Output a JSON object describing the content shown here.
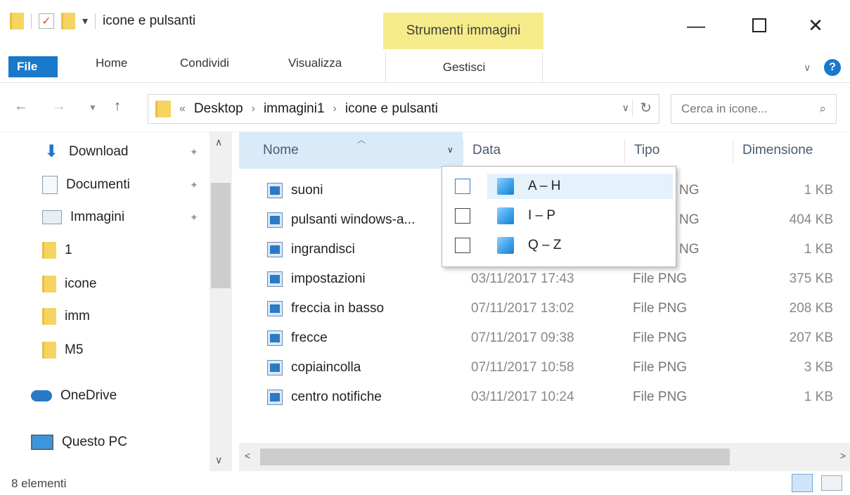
{
  "window": {
    "title": "icone e pulsanti",
    "contextual_tab": "Strumenti immagini",
    "minimize_glyph": "—",
    "maximize_glyph": "☐",
    "close_glyph": "✕"
  },
  "ribbon": {
    "tabs": [
      "File",
      "Home",
      "Condividi",
      "Visualizza"
    ],
    "contextual_subtab": "Gestisci",
    "help": "?"
  },
  "address": {
    "overflow": "«",
    "crumbs": [
      "Desktop",
      "immagini1",
      "icone e pulsanti"
    ],
    "search_placeholder": "Cerca in icone..."
  },
  "nav_pane": {
    "items": [
      {
        "label": "Download",
        "icon": "download-icon",
        "pinned": true
      },
      {
        "label": "Documenti",
        "icon": "documents-icon",
        "pinned": true
      },
      {
        "label": "Immagini",
        "icon": "pictures-icon",
        "pinned": true
      },
      {
        "label": "1",
        "icon": "folder-icon",
        "pinned": false
      },
      {
        "label": "icone",
        "icon": "folder-icon",
        "pinned": false
      },
      {
        "label": "imm",
        "icon": "folder-icon",
        "pinned": false
      },
      {
        "label": "M5",
        "icon": "folder-icon",
        "pinned": false
      },
      {
        "label": "OneDrive",
        "icon": "onedrive-icon",
        "pinned": false
      },
      {
        "label": "Questo PC",
        "icon": "this-pc-icon",
        "pinned": false
      }
    ]
  },
  "columns": {
    "name": "Nome",
    "date": "Data",
    "type": "Tipo",
    "size": "Dimensione"
  },
  "files": [
    {
      "name": "suoni",
      "date": "",
      "type": "",
      "size": "1 KB"
    },
    {
      "name": "pulsanti windows-a...",
      "date": "",
      "type": "",
      "size": "404 KB"
    },
    {
      "name": "ingrandisci",
      "date": "",
      "type": "",
      "size": "1 KB"
    },
    {
      "name": "impostazioni",
      "date": "03/11/2017 17:43",
      "type": "File PNG",
      "size": "375 KB"
    },
    {
      "name": "freccia in basso",
      "date": "07/11/2017 13:02",
      "type": "File PNG",
      "size": "208 KB"
    },
    {
      "name": "frecce",
      "date": "07/11/2017 09:38",
      "type": "File PNG",
      "size": "207 KB"
    },
    {
      "name": "copiaincolla",
      "date": "07/11/2017 10:58",
      "type": "File PNG",
      "size": "3 KB"
    },
    {
      "name": "centro notifiche",
      "date": "03/11/2017 10:24",
      "type": "File PNG",
      "size": "1 KB"
    }
  ],
  "hidden_type_fragments": [
    "NG",
    "NG",
    "NG"
  ],
  "filter_popup": {
    "items": [
      {
        "label": "A – H",
        "checked": false
      },
      {
        "label": "I – P",
        "checked": false
      },
      {
        "label": "Q – Z",
        "checked": false
      }
    ]
  },
  "status": {
    "count": "8 elementi"
  }
}
